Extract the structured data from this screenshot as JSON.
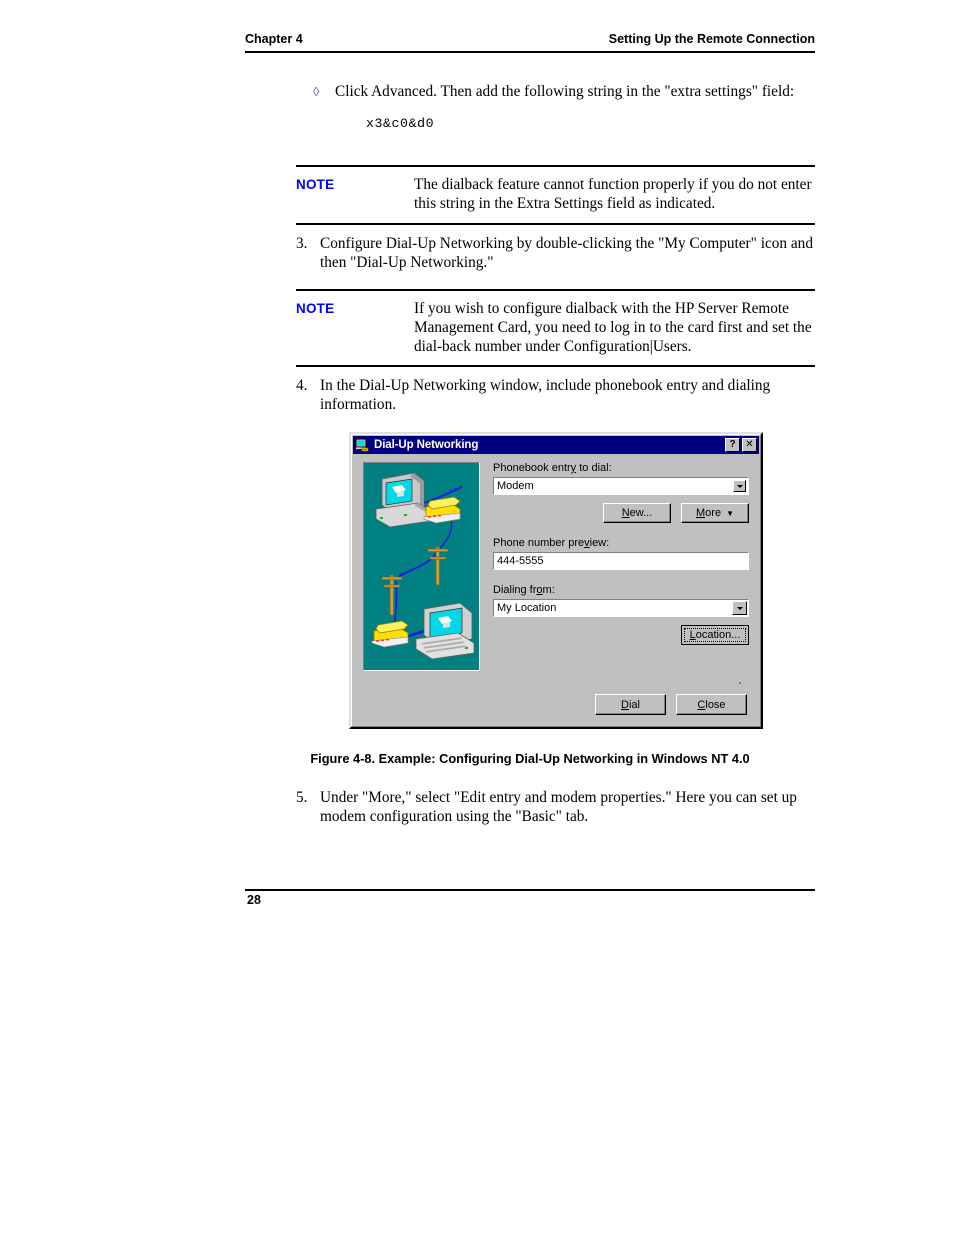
{
  "header": {
    "left": "Chapter 4",
    "right": "Setting Up the Remote Connection"
  },
  "bullet_item": {
    "marker": "◊",
    "text": "Click Advanced. Then add the following string in the \"extra settings\" field:",
    "code": "x3&c0&d0"
  },
  "notes": [
    {
      "tag": "NOTE",
      "body": "The dialback feature cannot function properly if you do not enter this string in the Extra Settings field as indicated."
    },
    {
      "tag": "NOTE",
      "body": "If you wish to configure dialback with the HP Server Remote Management Card, you need to log in to the card first and set the dial-back number under Configuration|Users."
    }
  ],
  "steps": [
    {
      "number": "3.",
      "text": "Configure Dial-Up Networking by double-clicking the \"My Computer\" icon and then \"Dial-Up Networking.\""
    },
    {
      "number": "4.",
      "text": "In the Dial-Up Networking window, include phonebook entry and dialing information."
    },
    {
      "number": "5.",
      "text": "Under \"More,\" select \"Edit entry and modem properties.\" Here you can set up modem configuration using the \"Basic\" tab."
    }
  ],
  "figure": {
    "caption": "Figure 4-8.  Example: Configuring Dial-Up Networking in Windows NT 4.0"
  },
  "footer": {
    "page_number": "28"
  },
  "dialog": {
    "title": "Dial-Up Networking",
    "icon": "dialup-networking-icon",
    "help_button": "?",
    "close_button": "✕",
    "illustration_alt": "dial-up-network-illustration",
    "fields": {
      "phonebook_label_pre": "Phonebook entr",
      "phonebook_label_key": "y",
      "phonebook_label_post": " to dial:",
      "phonebook_value": "Modem",
      "phone_preview_label_pre": "Phone number pre",
      "phone_preview_label_key": "v",
      "phone_preview_label_post": "iew:",
      "phone_preview_value": "444-5555",
      "dialing_from_label_pre": "Dialing fr",
      "dialing_from_label_key": "o",
      "dialing_from_label_post": "m:",
      "dialing_from_value": "My Location"
    },
    "buttons": {
      "new_pre": "",
      "new_key": "N",
      "new_post": "ew...",
      "more_pre": "",
      "more_key": "M",
      "more_post": "ore",
      "more_arrow": "▼",
      "location_pre": "",
      "location_key": "L",
      "location_post": "ocation...",
      "dial_pre": "",
      "dial_key": "D",
      "dial_post": "ial",
      "close_pre": "",
      "close_key": "C",
      "close_post": "lose"
    }
  },
  "colors": {
    "note_accent": "#0000ff",
    "bullet_accent": "#5a5ad0",
    "titlebar": "#000080",
    "dialog_face": "#c0c0c0",
    "illustration_bg": "#008080",
    "phone_yellow": "#ffe000",
    "screen_cyan": "#00e0f0",
    "wire_blue": "#1818e8"
  }
}
